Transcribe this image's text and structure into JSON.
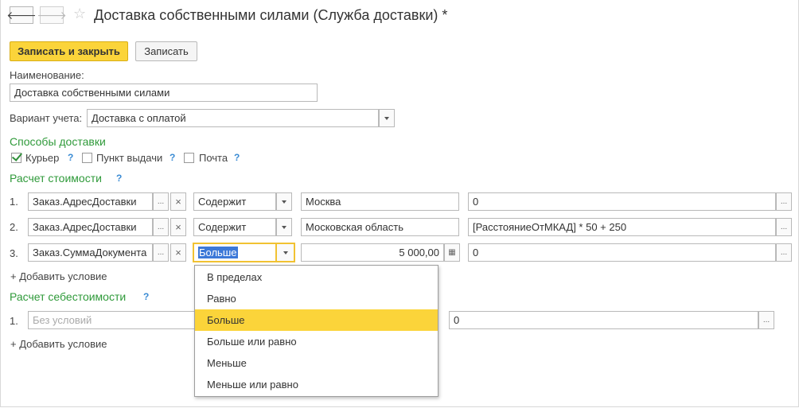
{
  "window": {
    "title": "Доставка собственными силами (Служба доставки) *"
  },
  "nav": {
    "back_glyph": "🡐",
    "forward_glyph": "🡒",
    "star_glyph": "☆"
  },
  "toolbar": {
    "save_close_label": "Записать и закрыть",
    "save_label": "Записать"
  },
  "form": {
    "name_label": "Наименование:",
    "name_value": "Доставка собственными силами",
    "accounting_label": "Вариант учета:",
    "accounting_value": "Доставка с оплатой"
  },
  "delivery_methods": {
    "title": "Способы доставки",
    "help": "?",
    "items": [
      {
        "label": "Курьер",
        "checked": true
      },
      {
        "label": "Пункт выдачи",
        "checked": false
      },
      {
        "label": "Почта",
        "checked": false
      }
    ]
  },
  "cost_calc": {
    "title": "Расчет стоимости",
    "help": "?",
    "rows": [
      {
        "num": "1.",
        "field": "Заказ.АдресДоставки",
        "condition": "Содержит",
        "value": "Москва",
        "formula": "0"
      },
      {
        "num": "2.",
        "field": "Заказ.АдресДоставки",
        "condition": "Содержит",
        "value": "Московская область",
        "formula": "[РасстояниеОтМКАД] * 50 + 250"
      },
      {
        "num": "3.",
        "field": "Заказ.СуммаДокумента",
        "condition": "Больше",
        "value": "5 000,00",
        "formula": "0"
      }
    ],
    "add_condition": "+ Добавить условие"
  },
  "prime_cost": {
    "title": "Расчет себестоимости",
    "help": "?",
    "rows": [
      {
        "num": "1.",
        "field_placeholder": "Без условий",
        "formula": "0"
      }
    ],
    "add_condition": "+ Добавить условие"
  },
  "buttons": {
    "ellipsis": "...",
    "clear": "×",
    "calc_glyph": "▦"
  },
  "dropdown": {
    "options": [
      "В пределах",
      "Равно",
      "Больше",
      "Больше или равно",
      "Меньше",
      "Меньше или равно"
    ],
    "selected": "Больше"
  }
}
